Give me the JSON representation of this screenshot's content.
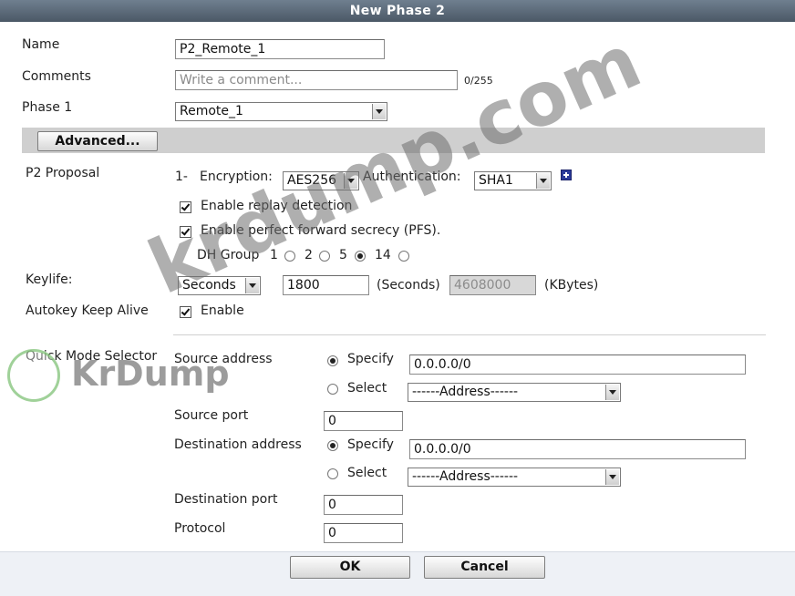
{
  "window": {
    "title": "New Phase 2"
  },
  "labels": {
    "name": "Name",
    "comments": "Comments",
    "phase1": "Phase 1",
    "p2_proposal": "P2 Proposal",
    "keylife": "Keylife:",
    "autokey": "Autokey Keep Alive",
    "quick_mode": "Quick Mode Selector",
    "source_address": "Source address",
    "source_port": "Source port",
    "destination_address": "Destination address",
    "destination_port": "Destination port",
    "protocol": "Protocol"
  },
  "fields": {
    "name_value": "P2_Remote_1",
    "comment_placeholder": "Write a comment...",
    "comment_counter": "0/255",
    "phase1_value": "Remote_1"
  },
  "advanced": {
    "label": "Advanced..."
  },
  "proposal": {
    "index": "1-",
    "encryption_label": "Encryption:",
    "encryption_value": "AES256",
    "authentication_label": "Authentication:",
    "authentication_value": "SHA1",
    "replay_label": "Enable replay detection",
    "pfs_label": "Enable perfect forward secrecy (PFS).",
    "dh_group_label": "DH Group",
    "dh_options": [
      "1",
      "2",
      "5",
      "14"
    ],
    "dh_selected": "5"
  },
  "keylife": {
    "unit": "Seconds",
    "seconds_value": "1800",
    "seconds_unit_label": "(Seconds)",
    "kbytes_value": "4608000",
    "kbytes_unit_label": "(KBytes)"
  },
  "autokey": {
    "enable_label": "Enable"
  },
  "quick_mode": {
    "specify_label": "Specify",
    "select_label": "Select",
    "source_address_value": "0.0.0.0/0",
    "source_select_value": "------Address------",
    "source_port_value": "0",
    "destination_address_value": "0.0.0.0/0",
    "destination_select_value": "------Address------",
    "destination_port_value": "0",
    "protocol_value": "0"
  },
  "buttons": {
    "ok": "OK",
    "cancel": "Cancel"
  },
  "watermark": {
    "main": "krdump.com",
    "logo_text": "KrDump"
  }
}
